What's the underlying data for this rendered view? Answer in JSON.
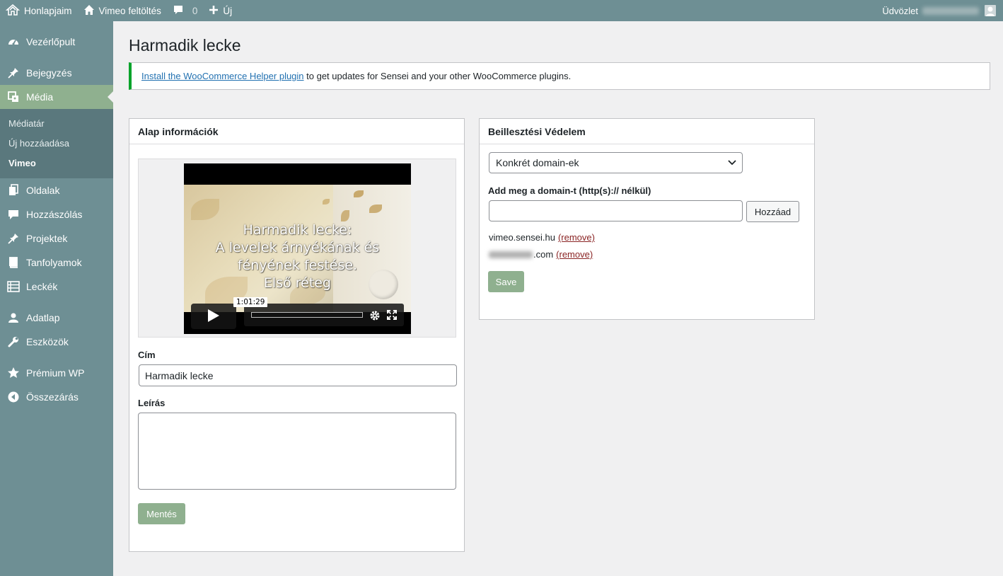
{
  "adminbar": {
    "site_name": "Honlapjaim",
    "upload_label": "Vimeo feltöltés",
    "comments_count": "0",
    "new_label": "Új",
    "greeting": "Üdvözlet"
  },
  "sidebar": {
    "dashboard": "Vezérlőpult",
    "posts": "Bejegyzés",
    "media": "Média",
    "media_sub": [
      "Médiatár",
      "Új hozzáadása",
      "Vimeo"
    ],
    "pages": "Oldalak",
    "comments": "Hozzászólás",
    "projects": "Projektek",
    "courses": "Tanfolyamok",
    "lessons": "Leckék",
    "profile": "Adatlap",
    "tools": "Eszközök",
    "premium": "Prémium WP",
    "collapse": "Összezárás"
  },
  "page": {
    "title": "Harmadik lecke"
  },
  "notice": {
    "link_text": "Install the WooCommerce Helper plugin",
    "rest_text": " to get updates for Sensei and your other WooCommerce plugins."
  },
  "basic_info": {
    "header": "Alap információk",
    "video": {
      "title_lines": [
        "Harmadik lecke:",
        "A levelek árnyékának és",
        "fényének festése.",
        "Első réteg"
      ],
      "duration": "1:01:29"
    },
    "title_label": "Cím",
    "title_value": "Harmadik lecke",
    "description_label": "Leírás",
    "description_value": "",
    "save_label": "Mentés"
  },
  "embed_protection": {
    "header": "Beillesztési Védelem",
    "select_value": "Konkrét domain-ek",
    "domain_label": "Add meg a domain-t (http(s):// nélkül)",
    "domain_input_value": "",
    "add_button": "Hozzáad",
    "domains": [
      {
        "name": "vimeo.sensei.hu",
        "remove": "(remove)"
      },
      {
        "name": ".com",
        "remove": "(remove)"
      }
    ],
    "save_label": "Save"
  },
  "colors": {
    "sidebar_bg": "#6e8f94",
    "active_menu": "#8fb08f",
    "notice_border": "#00a32a",
    "link": "#2271b1",
    "remove_link": "#8a2424"
  }
}
